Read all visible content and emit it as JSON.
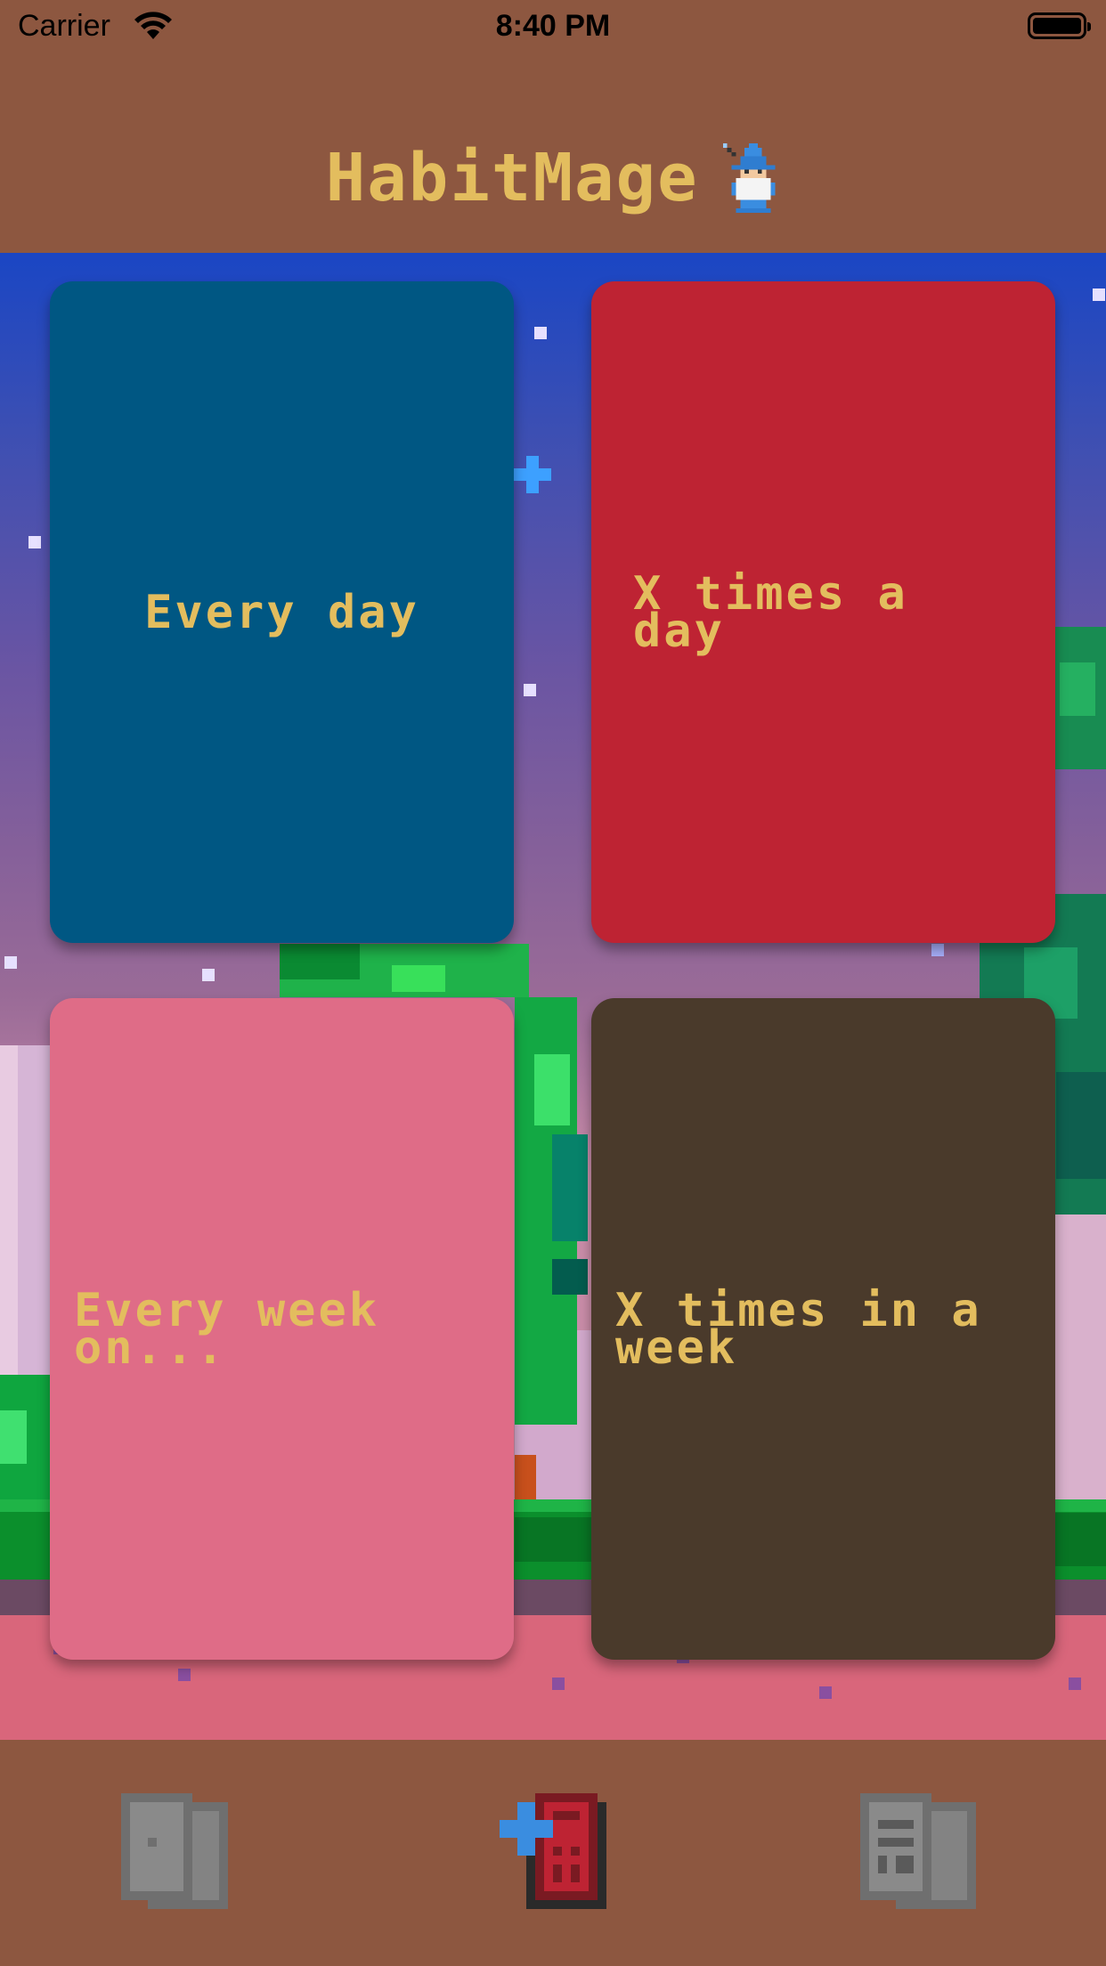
{
  "status_bar": {
    "carrier": "Carrier",
    "time": "8:40 PM"
  },
  "header": {
    "title": "HabitMage"
  },
  "habit_types": [
    {
      "label": "Every day",
      "color": "#005783"
    },
    {
      "label": "X times a day",
      "color": "#be2333"
    },
    {
      "label": "Every week on...",
      "color": "#df6c87"
    },
    {
      "label": "X times in a week",
      "color": "#4a3a2b"
    },
    {
      "label": "",
      "color": "#9f5f22"
    },
    {
      "label": "",
      "color": "#e88833"
    }
  ],
  "tabs": [
    {
      "icon": "habit-cards-icon",
      "selected": false
    },
    {
      "icon": "add-habit-icon",
      "selected": true
    },
    {
      "icon": "stats-documents-icon",
      "selected": false
    }
  ],
  "colors": {
    "background": "#8d5740",
    "title": "#e3bd5e"
  }
}
